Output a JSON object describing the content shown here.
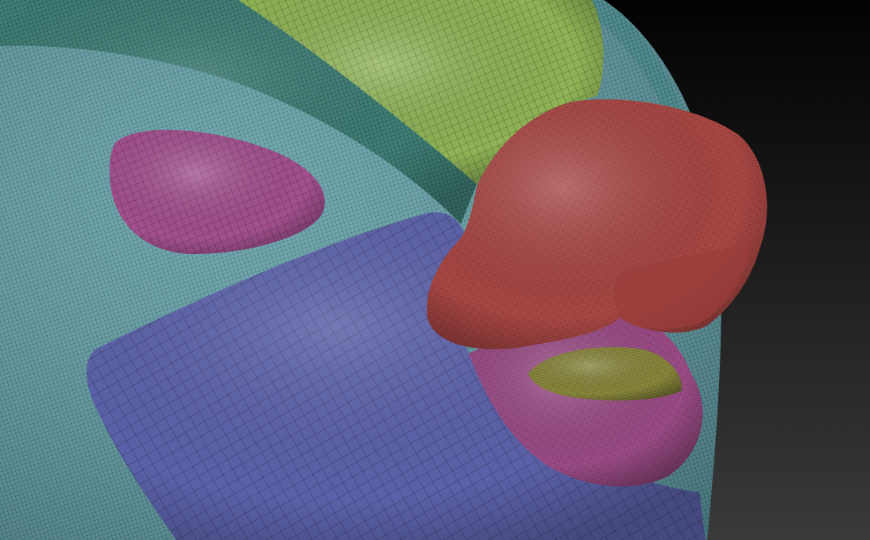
{
  "scene": {
    "background_top": "#020202",
    "background_bottom": "#3a3a3a",
    "polygroups": [
      {
        "name": "head",
        "color": "#5e9ea6"
      },
      {
        "name": "brow-band",
        "color": "#3f7f76"
      },
      {
        "name": "forehead-cap",
        "color": "#8fb355"
      },
      {
        "name": "eye-lid",
        "color": "#a3508e"
      },
      {
        "name": "cheek",
        "color": "#5b61a8"
      },
      {
        "name": "nose",
        "color": "#b34b48"
      },
      {
        "name": "lower-lip",
        "color": "#a3508e"
      },
      {
        "name": "tongue",
        "color": "#8f8f3f"
      }
    ],
    "wire_color": "#101418"
  }
}
